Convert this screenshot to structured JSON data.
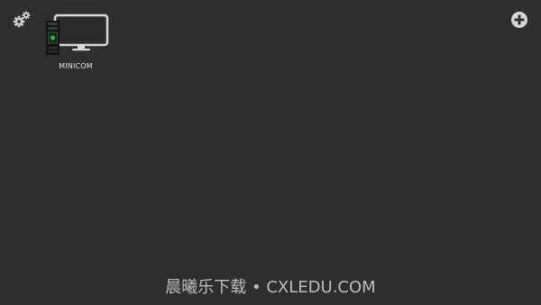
{
  "desktop": {
    "background_color": "#2e2e2e",
    "icons": [
      {
        "label": "MINICOM",
        "icon": "serial-terminal-monitor-icon"
      }
    ]
  },
  "toolbar": {
    "settings_icon": "gears-icon",
    "add_icon": "plus-circle-icon"
  },
  "watermark": {
    "text": "晨曦乐下载 • CXLEDU.COM"
  }
}
